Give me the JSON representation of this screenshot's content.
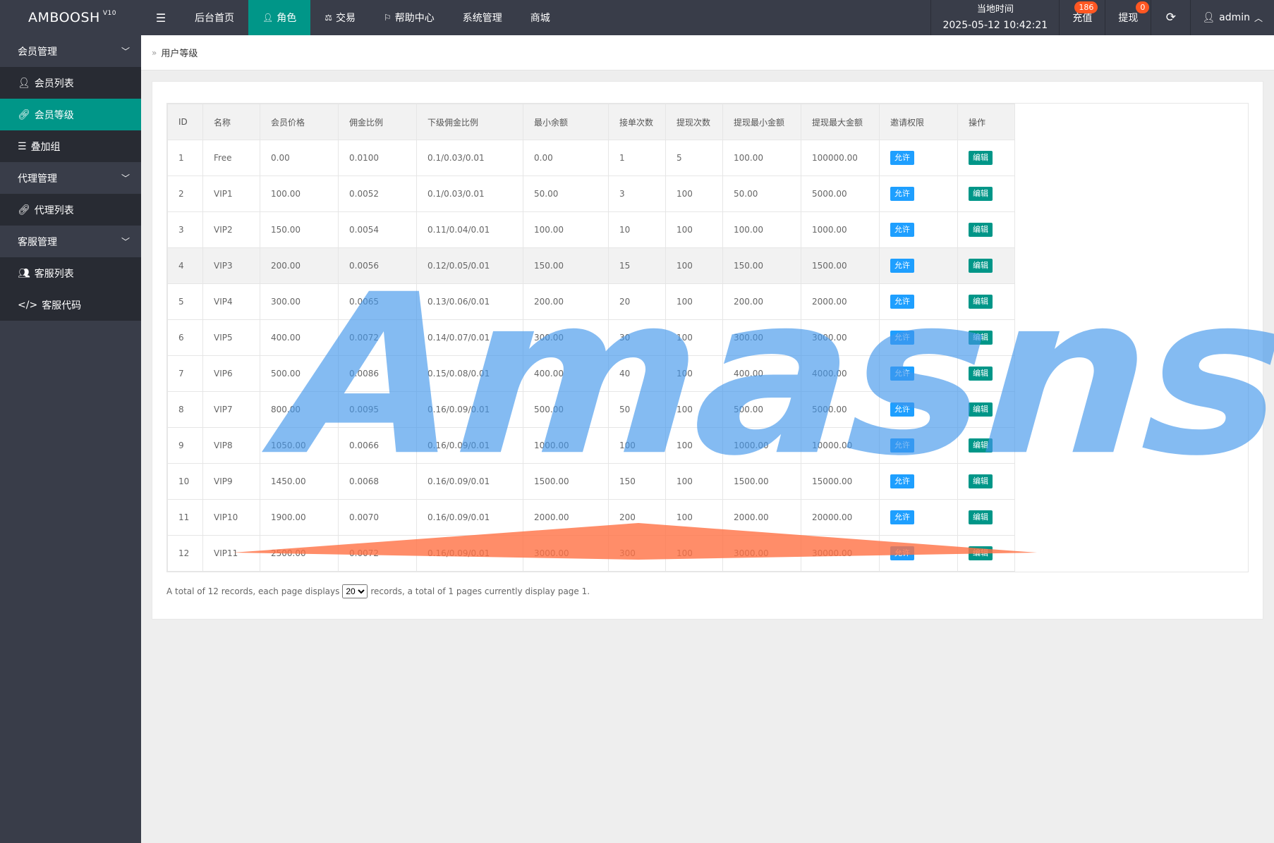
{
  "app": {
    "name": "AMBOOSH",
    "version": "V10"
  },
  "nav": [
    {
      "label": "后台首页",
      "icon": ""
    },
    {
      "label": "角色",
      "icon": "user-icon",
      "active": true
    },
    {
      "label": "交易",
      "icon": "balance-icon"
    },
    {
      "label": "帮助中心",
      "icon": "flag-icon"
    },
    {
      "label": "系统管理",
      "icon": ""
    },
    {
      "label": "商城",
      "icon": ""
    }
  ],
  "header": {
    "time_label": "当地时间",
    "time_value": "2025-05-12 10:42:21",
    "recharge_label": "充值",
    "recharge_badge": "186",
    "withdraw_label": "提现",
    "withdraw_badge": "0",
    "user": "admin"
  },
  "sidebar": {
    "groups": [
      {
        "label": "会员管理",
        "items": [
          {
            "label": "会员列表",
            "icon": "user-icon"
          },
          {
            "label": "会员等级",
            "icon": "link-icon",
            "active": true
          },
          {
            "label": "叠加组",
            "icon": "list-icon"
          }
        ]
      },
      {
        "label": "代理管理",
        "items": [
          {
            "label": "代理列表",
            "icon": "link-icon"
          }
        ]
      },
      {
        "label": "客服管理",
        "items": [
          {
            "label": "客服列表",
            "icon": "users-icon"
          },
          {
            "label": "客服代码",
            "icon": "code-icon"
          }
        ]
      }
    ]
  },
  "breadcrumb": {
    "current": "用户等级"
  },
  "table": {
    "headers": [
      "ID",
      "名称",
      "会员价格",
      "佣金比例",
      "下级佣金比例",
      "最小余额",
      "接单次数",
      "提现次数",
      "提现最小金额",
      "提现最大金额",
      "邀请权限",
      "操作"
    ],
    "allow_label": "允许",
    "edit_label": "编辑",
    "rows": [
      [
        "1",
        "Free",
        "0.00",
        "0.0100",
        "0.1/0.03/0.01",
        "0.00",
        "1",
        "5",
        "100.00",
        "100000.00"
      ],
      [
        "2",
        "VIP1",
        "100.00",
        "0.0052",
        "0.1/0.03/0.01",
        "50.00",
        "3",
        "100",
        "50.00",
        "5000.00"
      ],
      [
        "3",
        "VIP2",
        "150.00",
        "0.0054",
        "0.11/0.04/0.01",
        "100.00",
        "10",
        "100",
        "100.00",
        "1000.00"
      ],
      [
        "4",
        "VIP3",
        "200.00",
        "0.0056",
        "0.12/0.05/0.01",
        "150.00",
        "15",
        "100",
        "150.00",
        "1500.00"
      ],
      [
        "5",
        "VIP4",
        "300.00",
        "0.0065",
        "0.13/0.06/0.01",
        "200.00",
        "20",
        "100",
        "200.00",
        "2000.00"
      ],
      [
        "6",
        "VIP5",
        "400.00",
        "0.0072",
        "0.14/0.07/0.01",
        "300.00",
        "30",
        "100",
        "300.00",
        "3000.00"
      ],
      [
        "7",
        "VIP6",
        "500.00",
        "0.0086",
        "0.15/0.08/0.01",
        "400.00",
        "40",
        "100",
        "400.00",
        "4000.00"
      ],
      [
        "8",
        "VIP7",
        "800.00",
        "0.0095",
        "0.16/0.09/0.01",
        "500.00",
        "50",
        "100",
        "500.00",
        "5000.00"
      ],
      [
        "9",
        "VIP8",
        "1050.00",
        "0.0066",
        "0.16/0.09/0.01",
        "1000.00",
        "100",
        "100",
        "1000.00",
        "10000.00"
      ],
      [
        "10",
        "VIP9",
        "1450.00",
        "0.0068",
        "0.16/0.09/0.01",
        "1500.00",
        "150",
        "100",
        "1500.00",
        "15000.00"
      ],
      [
        "11",
        "VIP10",
        "1900.00",
        "0.0070",
        "0.16/0.09/0.01",
        "2000.00",
        "200",
        "100",
        "2000.00",
        "20000.00"
      ],
      [
        "12",
        "VIP11",
        "2500.00",
        "0.0072",
        "0.16/0.09/0.01",
        "3000.00",
        "300",
        "100",
        "3000.00",
        "30000.00"
      ]
    ],
    "highlight_row": 3
  },
  "pager": {
    "text_before": "A total of 12 records, each page displays",
    "page_size": "20",
    "text_after": "records, a total of 1 pages currently display page 1."
  },
  "watermark": {
    "text": "Amasns"
  },
  "colors": {
    "topbar": "#393d49",
    "accent": "#009688",
    "blue": "#1e9fff",
    "badge": "#ff5722"
  }
}
